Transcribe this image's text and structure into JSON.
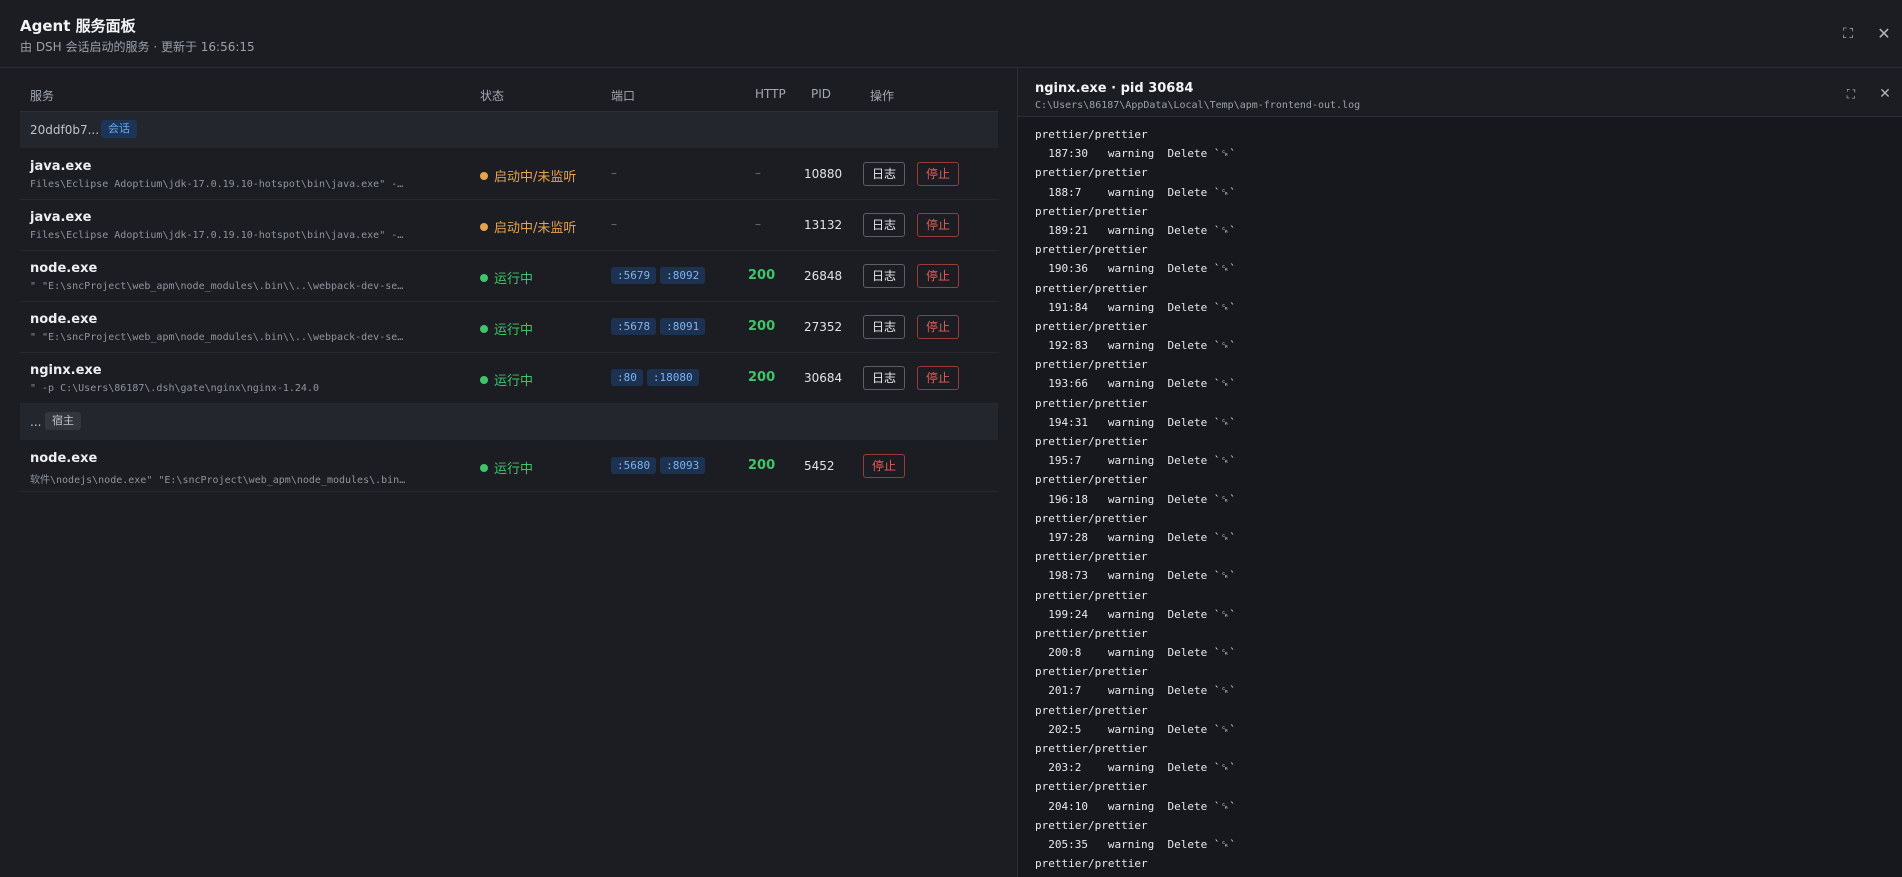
{
  "header": {
    "title": "Agent 服务面板",
    "subtitle": "由 DSH 会话启动的服务 · 更新于 16:56:15",
    "expand_icon": "⛶",
    "close_icon": "✕"
  },
  "table": {
    "columns": [
      "服务",
      "状态",
      "端口",
      "HTTP",
      "PID",
      "操作"
    ],
    "log_label": "日志",
    "stop_label": "停止",
    "groups": [
      {
        "name": "20ddf0b7...",
        "tag": "会话",
        "rows": [
          {
            "name": "java.exe",
            "cmd": "Files\\Eclipse Adoptium\\jdk-17.0.19.10-hotspot\\bin\\java.exe\" -…",
            "status": "启动中/未监听",
            "ports": [],
            "ports_empty": "–",
            "http": "–",
            "pid": "10880"
          },
          {
            "name": "java.exe",
            "cmd": "Files\\Eclipse Adoptium\\jdk-17.0.19.10-hotspot\\bin\\java.exe\" -…",
            "status": "启动中/未监听",
            "ports": [],
            "ports_empty": "–",
            "http": "–",
            "pid": "13132"
          },
          {
            "name": "node.exe",
            "cmd": "\" \"E:\\sncProject\\web_apm\\node_modules\\.bin\\\\..\\webpack-dev-se…",
            "status": "运行中",
            "ports": [
              ":5679",
              ":8092"
            ],
            "http": "200",
            "pid": "26848"
          },
          {
            "name": "node.exe",
            "cmd": "\" \"E:\\sncProject\\web_apm\\node_modules\\.bin\\\\..\\webpack-dev-se…",
            "status": "运行中",
            "ports": [
              ":5678",
              ":8091"
            ],
            "http": "200",
            "pid": "27352"
          },
          {
            "name": "nginx.exe",
            "cmd": "\" -p C:\\Users\\86187\\.dsh\\gate\\nginx\\nginx-1.24.0",
            "status": "运行中",
            "ports": [
              ":80",
              ":18080"
            ],
            "http": "200",
            "pid": "30684"
          }
        ]
      },
      {
        "name": "...",
        "tag": "宿主",
        "rows": [
          {
            "name": "node.exe",
            "cmd": "软件\\nodejs\\node.exe\" \"E:\\sncProject\\web_apm\\node_modules\\.bin…",
            "status": "运行中",
            "ports": [
              ":5680",
              ":8093"
            ],
            "http": "200",
            "pid": "5452"
          }
        ]
      }
    ]
  },
  "log_panel": {
    "title": "nginx.exe · pid 30684",
    "path": "C:\\Users\\86187\\AppData\\Local\\Temp\\apm-frontend-out.log",
    "expand_icon": "⛶",
    "close_icon": "✕",
    "lines": [
      "prettier/prettier",
      "  187:30   warning  Delete `␍`",
      "prettier/prettier",
      "  188:7    warning  Delete `␍`",
      "prettier/prettier",
      "  189:21   warning  Delete `␍`",
      "prettier/prettier",
      "  190:36   warning  Delete `␍`",
      "prettier/prettier",
      "  191:84   warning  Delete `␍`",
      "prettier/prettier",
      "  192:83   warning  Delete `␍`",
      "prettier/prettier",
      "  193:66   warning  Delete `␍`",
      "prettier/prettier",
      "  194:31   warning  Delete `␍`",
      "prettier/prettier",
      "  195:7    warning  Delete `␍`",
      "prettier/prettier",
      "  196:18   warning  Delete `␍`",
      "prettier/prettier",
      "  197:28   warning  Delete `␍`",
      "prettier/prettier",
      "  198:73   warning  Delete `␍`",
      "prettier/prettier",
      "  199:24   warning  Delete `␍`",
      "prettier/prettier",
      "  200:8    warning  Delete `␍`",
      "prettier/prettier",
      "  201:7    warning  Delete `␍`",
      "prettier/prettier",
      "  202:5    warning  Delete `␍`",
      "prettier/prettier",
      "  203:2    warning  Delete `␍`",
      "prettier/prettier",
      "  204:10   warning  Delete `␍`",
      "prettier/prettier",
      "  205:35   warning  Delete `␍`",
      "prettier/prettier"
    ]
  }
}
